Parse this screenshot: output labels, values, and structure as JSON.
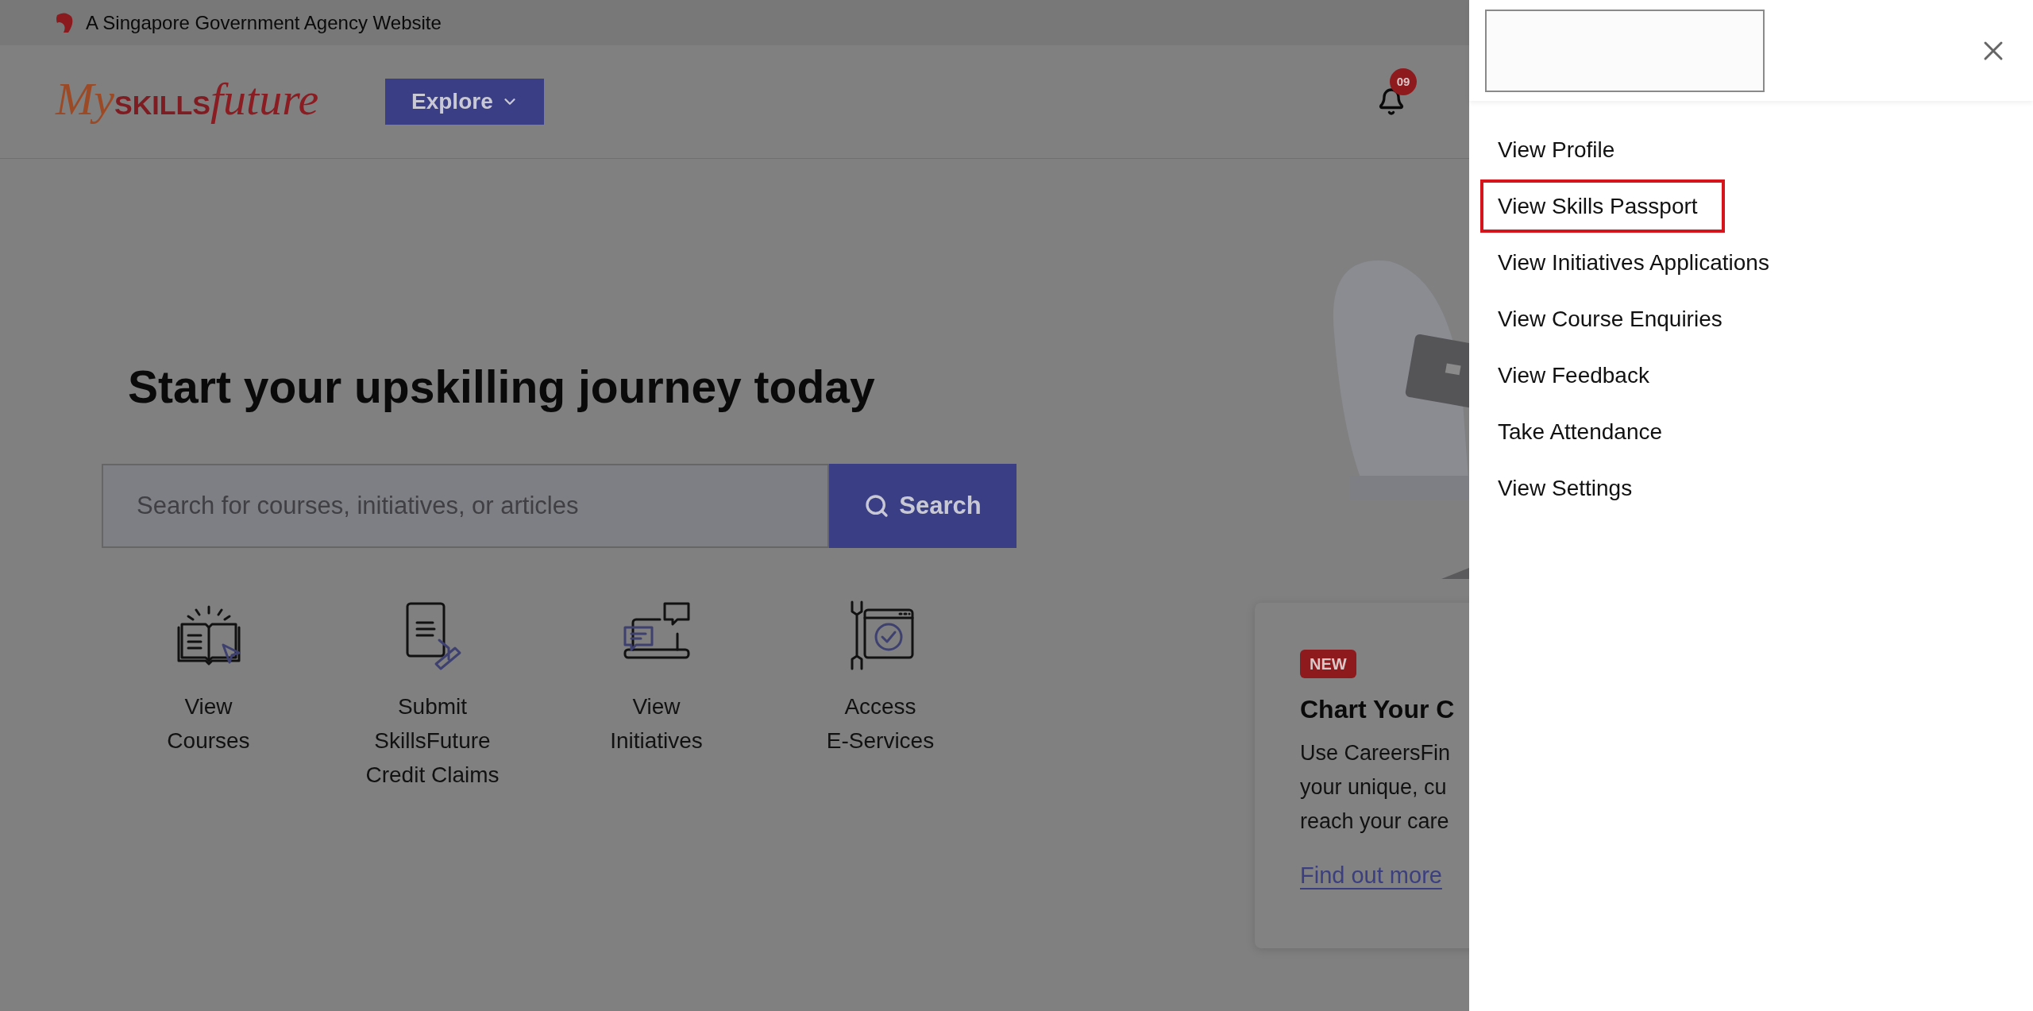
{
  "top_bar": {
    "text": "A Singapore Government Agency Website"
  },
  "header": {
    "logo": [
      "My",
      "SKILLS",
      "future"
    ],
    "explore_button": "Explore",
    "notifications": {
      "count": "09"
    }
  },
  "hero": {
    "title": "Start your upskilling journey today",
    "search": {
      "placeholder": "Search for courses, initiatives, or articles",
      "button": "Search"
    },
    "shortcuts": [
      {
        "kind": "book",
        "label_lines": [
          "View",
          "Courses"
        ]
      },
      {
        "kind": "document",
        "label_lines": [
          "Submit",
          "SkillsFuture",
          "Credit Claims"
        ]
      },
      {
        "kind": "laptop",
        "label_lines": [
          "View",
          "Initiatives"
        ]
      },
      {
        "kind": "tools",
        "label_lines": [
          "Access",
          "E-Services"
        ]
      }
    ]
  },
  "card": {
    "badge": "NEW",
    "title": "Chart Your C",
    "body_lines": [
      "Use CareersFin",
      "your unique, cu",
      "reach your care"
    ],
    "link": "Find out more"
  },
  "panel": {
    "items": [
      {
        "label": "View Profile",
        "highlighted": false
      },
      {
        "label": "View Skills Passport",
        "highlighted": true
      },
      {
        "label": "View Initiatives Applications",
        "highlighted": false
      },
      {
        "label": "View Course Enquiries",
        "highlighted": false
      },
      {
        "label": "View Feedback",
        "highlighted": false
      },
      {
        "label": "Take Attendance",
        "highlighted": false
      },
      {
        "label": "View Settings",
        "highlighted": false
      }
    ]
  }
}
